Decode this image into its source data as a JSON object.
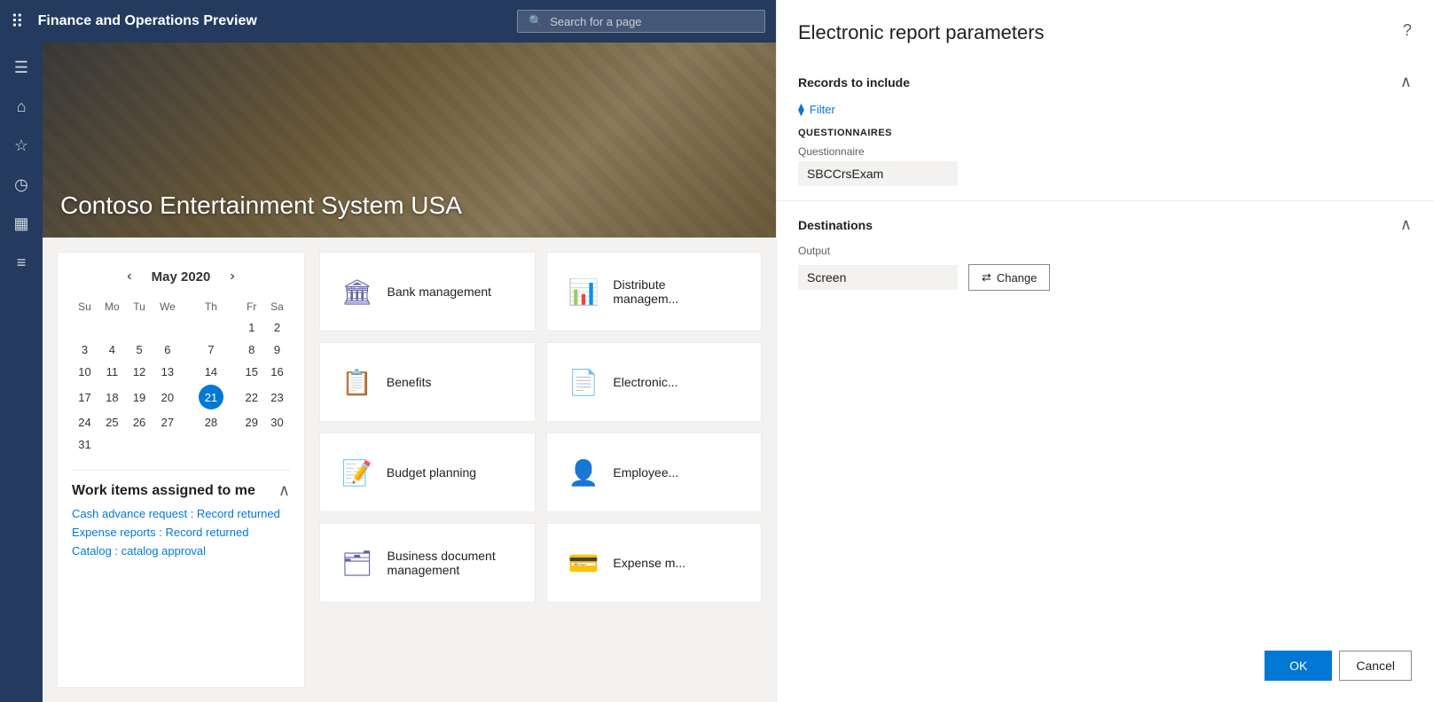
{
  "app": {
    "title": "Finance and Operations Preview",
    "search_placeholder": "Search for a page"
  },
  "hero": {
    "title": "Contoso Entertainment System USA"
  },
  "calendar": {
    "month": "May",
    "year": "2020",
    "days_of_week": [
      "Su",
      "Mo",
      "Tu",
      "We",
      "Th",
      "Fr",
      "Sa"
    ],
    "weeks": [
      [
        "",
        "",
        "",
        "",
        "",
        "1",
        "2"
      ],
      [
        "3",
        "4",
        "5",
        "6",
        "7",
        "8",
        "9"
      ],
      [
        "10",
        "11",
        "12",
        "13",
        "14",
        "15",
        "16"
      ],
      [
        "17",
        "18",
        "19",
        "20",
        "21",
        "22",
        "23"
      ],
      [
        "24",
        "25",
        "26",
        "27",
        "28",
        "29",
        "30"
      ],
      [
        "31",
        "",
        "",
        "",
        "",
        "",
        ""
      ]
    ],
    "today": "21"
  },
  "work_items": {
    "title": "Work items assigned to me",
    "items": [
      "Cash advance request : Record returned",
      "Expense reports : Record returned",
      "Catalog : catalog approval"
    ]
  },
  "tiles": [
    {
      "label": "Bank management"
    },
    {
      "label": "Distributed\nmanagem..."
    },
    {
      "label": "Benefits"
    },
    {
      "label": "Electronic..."
    },
    {
      "label": "Budget planning"
    },
    {
      "label": "Employee..."
    },
    {
      "label": "Business document\nmanagement"
    },
    {
      "label": "Expense m..."
    }
  ],
  "right_panel": {
    "title": "Electronic report parameters",
    "sections": {
      "records_to_include": {
        "label": "Records to include",
        "filter_label": "Filter",
        "questionnaires_label": "QUESTIONNAIRES",
        "questionnaire_field_label": "Questionnaire",
        "questionnaire_value": "SBCCrsExam"
      },
      "destinations": {
        "label": "Destinations",
        "output_label": "Output",
        "output_value": "Screen",
        "change_label": "Change"
      }
    },
    "ok_label": "OK",
    "cancel_label": "Cancel"
  },
  "sidebar_icons": [
    {
      "name": "hamburger-menu-icon",
      "glyph": "☰"
    },
    {
      "name": "home-icon",
      "glyph": "⌂"
    },
    {
      "name": "favorites-icon",
      "glyph": "☆"
    },
    {
      "name": "recent-icon",
      "glyph": "🕐"
    },
    {
      "name": "workspace-icon",
      "glyph": "▦"
    },
    {
      "name": "list-icon",
      "glyph": "≡"
    }
  ]
}
